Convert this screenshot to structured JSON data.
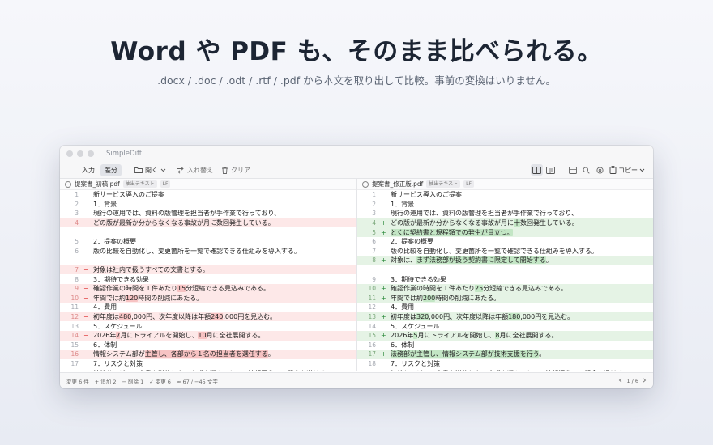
{
  "hero": {
    "title": "Word や PDF も、そのまま比べられる。",
    "subtitle": ".docx / .doc / .odt / .rtf / .pdf から本文を取り出して比較。事前の変換はいりません。"
  },
  "window": {
    "app_title": "SimpleDiff"
  },
  "toolbar": {
    "mode_input": "入力",
    "mode_diff": "差分",
    "open_label": "開く",
    "swap_label": "入れ替え",
    "clear_label": "クリア",
    "copy_label": "コピー"
  },
  "left_pane": {
    "filename": "提案書_初稿.pdf",
    "badge_text": "抽出テキスト",
    "badge_eol": "LF",
    "lines": [
      {
        "n": "1",
        "type": "normal",
        "segs": [
          {
            "t": "新サービス導入のご提案",
            "h": false
          }
        ]
      },
      {
        "n": "2",
        "type": "normal",
        "segs": [
          {
            "t": "1．背景",
            "h": false
          }
        ]
      },
      {
        "n": "3",
        "type": "normal",
        "segs": [
          {
            "t": "現行の運用では、資料の版管理を担当者が手作業で行っており、",
            "h": false
          }
        ]
      },
      {
        "n": "4",
        "type": "removed",
        "segs": [
          {
            "t": "どの版が最新か分からなくなる事故が月に数回発生している。",
            "h": false
          }
        ]
      },
      {
        "n": "",
        "type": "empty",
        "segs": []
      },
      {
        "n": "5",
        "type": "normal",
        "segs": [
          {
            "t": "2．提案の概要",
            "h": false
          }
        ]
      },
      {
        "n": "6",
        "type": "normal",
        "segs": [
          {
            "t": "版の比較を自動化し、変更箇所を一覧で確認できる仕組みを導入する。",
            "h": false
          }
        ]
      },
      {
        "n": "",
        "type": "empty",
        "segs": []
      },
      {
        "n": "7",
        "type": "removed",
        "segs": [
          {
            "t": "対象は社内で扱うすべての文書とする。",
            "h": false
          }
        ]
      },
      {
        "n": "8",
        "type": "normal",
        "segs": [
          {
            "t": "3．期待できる効果",
            "h": false
          }
        ]
      },
      {
        "n": "9",
        "type": "removed",
        "segs": [
          {
            "t": "確認作業の時間を１件あたり",
            "h": false
          },
          {
            "t": "15",
            "h": true
          },
          {
            "t": "分短縮できる見込みである。",
            "h": false
          }
        ]
      },
      {
        "n": "10",
        "type": "removed",
        "segs": [
          {
            "t": "年間では約",
            "h": false
          },
          {
            "t": "120",
            "h": true
          },
          {
            "t": "時間の削減にあたる。",
            "h": false
          }
        ]
      },
      {
        "n": "11",
        "type": "normal",
        "segs": [
          {
            "t": "4．費用",
            "h": false
          }
        ]
      },
      {
        "n": "12",
        "type": "removed",
        "segs": [
          {
            "t": "初年度は",
            "h": false
          },
          {
            "t": "480",
            "h": true
          },
          {
            "t": ",000円、次年度以降は年額",
            "h": false
          },
          {
            "t": "240",
            "h": true
          },
          {
            "t": ",000円を見込む。",
            "h": false
          }
        ]
      },
      {
        "n": "13",
        "type": "normal",
        "segs": [
          {
            "t": "5．スケジュール",
            "h": false
          }
        ]
      },
      {
        "n": "14",
        "type": "removed",
        "segs": [
          {
            "t": "2026年",
            "h": false
          },
          {
            "t": "7",
            "h": true
          },
          {
            "t": "月にトライアルを開始し、",
            "h": false
          },
          {
            "t": "10",
            "h": true
          },
          {
            "t": "月に全社展開する。",
            "h": false
          }
        ]
      },
      {
        "n": "15",
        "type": "normal",
        "segs": [
          {
            "t": "6．体制",
            "h": false
          }
        ]
      },
      {
        "n": "16",
        "type": "removed",
        "segs": [
          {
            "t": "情報システム部が",
            "h": false
          },
          {
            "t": "主管し、各部から１名の担当者を選任する",
            "h": true
          },
          {
            "t": "。",
            "h": false
          }
        ]
      },
      {
        "n": "17",
        "type": "normal",
        "segs": [
          {
            "t": "7．リスクと対策",
            "h": false
          }
        ]
      },
      {
        "n": "18",
        "type": "normal",
        "segs": [
          {
            "t": "社外サービスの文書を送信しない方式を選ぶことで、情報漏えいの懸念を避ける",
            "h": false
          }
        ]
      }
    ]
  },
  "right_pane": {
    "filename": "提案書_修正版.pdf",
    "badge_text": "抽出テキスト",
    "badge_eol": "LF",
    "lines": [
      {
        "n": "1",
        "type": "normal",
        "segs": [
          {
            "t": "新サービス導入のご提案",
            "h": false
          }
        ]
      },
      {
        "n": "2",
        "type": "normal",
        "segs": [
          {
            "t": "1．背景",
            "h": false
          }
        ]
      },
      {
        "n": "3",
        "type": "normal",
        "segs": [
          {
            "t": "現行の運用では、資料の版管理を担当者が手作業で行っており、",
            "h": false
          }
        ]
      },
      {
        "n": "4",
        "type": "added",
        "segs": [
          {
            "t": "どの版が最新か分からなくなる事故が月に",
            "h": false
          },
          {
            "t": "十",
            "h": true
          },
          {
            "t": "数回発生している。",
            "h": false
          }
        ]
      },
      {
        "n": "5",
        "type": "added",
        "segs": [
          {
            "t": "とくに契約書と規程類での発生が目立つ。",
            "h": true
          }
        ]
      },
      {
        "n": "6",
        "type": "normal",
        "segs": [
          {
            "t": "2．提案の概要",
            "h": false
          }
        ]
      },
      {
        "n": "7",
        "type": "normal",
        "segs": [
          {
            "t": "版の比較を自動化し、変更箇所を一覧で確認できる仕組みを導入する。",
            "h": false
          }
        ]
      },
      {
        "n": "8",
        "type": "added",
        "segs": [
          {
            "t": "対象は、",
            "h": false
          },
          {
            "t": "まず法務部が扱う契約書に限定して開始する",
            "h": true
          },
          {
            "t": "。",
            "h": false
          }
        ]
      },
      {
        "n": "",
        "type": "empty",
        "segs": []
      },
      {
        "n": "9",
        "type": "normal",
        "segs": [
          {
            "t": "3．期待できる効果",
            "h": false
          }
        ]
      },
      {
        "n": "10",
        "type": "added",
        "segs": [
          {
            "t": "確認作業の時間を１件あたり",
            "h": false
          },
          {
            "t": "25",
            "h": true
          },
          {
            "t": "分短縮できる見込みである。",
            "h": false
          }
        ]
      },
      {
        "n": "11",
        "type": "added",
        "segs": [
          {
            "t": "年間では約",
            "h": false
          },
          {
            "t": "200",
            "h": true
          },
          {
            "t": "時間の削減にあたる。",
            "h": false
          }
        ]
      },
      {
        "n": "12",
        "type": "normal",
        "segs": [
          {
            "t": "4．費用",
            "h": false
          }
        ]
      },
      {
        "n": "13",
        "type": "added",
        "segs": [
          {
            "t": "初年度は",
            "h": false
          },
          {
            "t": "320",
            "h": true
          },
          {
            "t": ",000円、次年度以降は年額",
            "h": false
          },
          {
            "t": "180",
            "h": true
          },
          {
            "t": ",000円を見込む。",
            "h": false
          }
        ]
      },
      {
        "n": "14",
        "type": "normal",
        "segs": [
          {
            "t": "5．スケジュール",
            "h": false
          }
        ]
      },
      {
        "n": "15",
        "type": "added",
        "segs": [
          {
            "t": "2026年",
            "h": false
          },
          {
            "t": "5",
            "h": true
          },
          {
            "t": "月にトライアルを開始し、",
            "h": false
          },
          {
            "t": "8",
            "h": true
          },
          {
            "t": "月に全社展開する。",
            "h": false
          }
        ]
      },
      {
        "n": "16",
        "type": "normal",
        "segs": [
          {
            "t": "6．体制",
            "h": false
          }
        ]
      },
      {
        "n": "17",
        "type": "added",
        "segs": [
          {
            "t": "法務部が主管し、情報システム部が技術支援を行う",
            "h": true
          },
          {
            "t": "。",
            "h": false
          }
        ]
      },
      {
        "n": "18",
        "type": "normal",
        "segs": [
          {
            "t": "7．リスクと対策",
            "h": false
          }
        ]
      },
      {
        "n": "19",
        "type": "normal",
        "segs": [
          {
            "t": "社外サービスの文書を送信しない方式を選ぶことで、情報漏えいの懸念を避ける",
            "h": false
          }
        ]
      }
    ]
  },
  "statusbar": {
    "changes": "変更 6 件",
    "added": "+ 追加 2",
    "deleted": "− 削除 1",
    "modified": "✓ 変更 6",
    "chars": "≈ 67 / −45 文字",
    "page": "1 / 6"
  },
  "colors": {
    "removed_bg": "#fde8e8",
    "removed_hl": "#f7c3c3",
    "added_bg": "#e5f3e5",
    "added_hl": "#c3e6c5"
  }
}
